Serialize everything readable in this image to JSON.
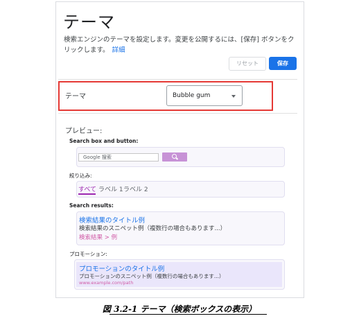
{
  "page": {
    "title": "テーマ",
    "description": "検索エンジンのテーマを設定します。変更を公開するには、[保存] ボタンをクリックします。",
    "details_link": "詳細",
    "reset_button": "リセット",
    "save_button": "保存"
  },
  "theme_setting": {
    "label": "テーマ",
    "selected": "Bubble gum"
  },
  "preview": {
    "label": "プレビュー:",
    "search_section": {
      "label": "Search box and button:",
      "input_value": "Google 搜索"
    },
    "refinement_section": {
      "label": "絞り込み:",
      "items": [
        "すべて",
        "ラベル 1",
        "ラベル 2"
      ]
    },
    "results_section": {
      "label": "Search results:",
      "title": "検索結果のタイトル例",
      "snippet": "検索結果のスニペット例（複数行の場合もあります...）",
      "url": "検索結果 > 例"
    },
    "promotion_section": {
      "label": "プロモーション:",
      "title": "プロモーションのタイトル例",
      "snippet": "プロモーションのスニペット例（複数行の場合もあります...）",
      "url": "www.example.com/path"
    }
  },
  "caption": "図 3.2-1 テーマ（検索ボックスの表示）",
  "colors": {
    "accent": "#1a73e8",
    "highlight_border": "#e53935",
    "bubble_gum_button": "#c792d6",
    "refinement_active": "#9c27b0",
    "url_color": "#d05ba6",
    "promo_background": "#eae6fb"
  },
  "icons": {
    "dropdown": "chevron-down-icon",
    "search": "search-icon"
  }
}
